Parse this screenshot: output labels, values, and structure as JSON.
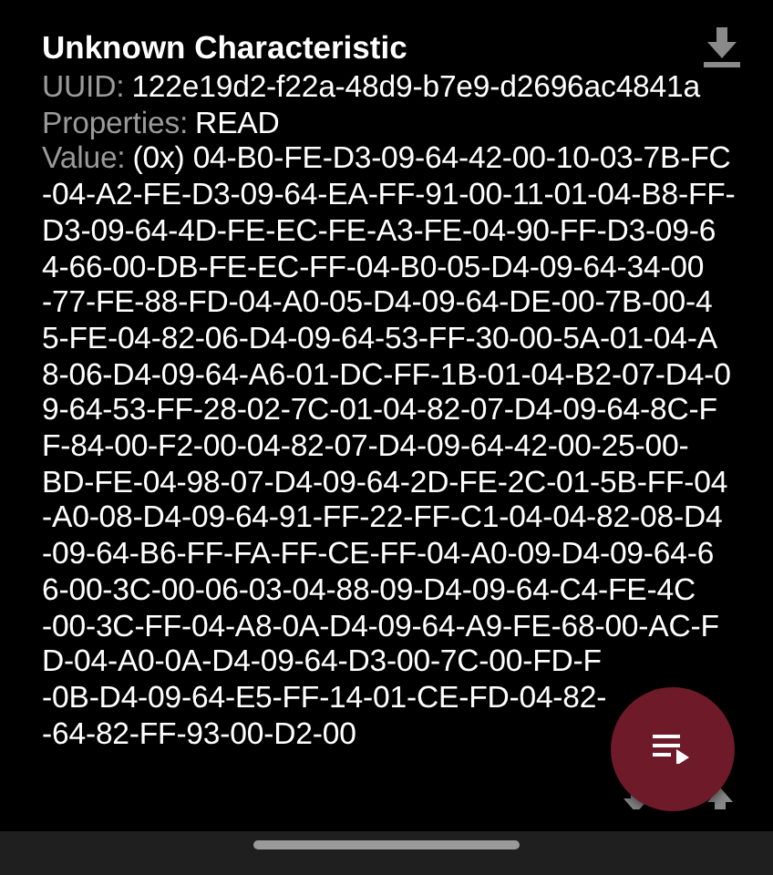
{
  "characteristic": {
    "title": "Unknown Characteristic",
    "uuid_label": "UUID:",
    "uuid": "122e19d2-f22a-48d9-b7e9-d2696ac4841a",
    "properties_label": "Properties:",
    "properties": "READ",
    "value_label": "Value:",
    "value_lines": [
      "(0x) 04-B0-FE-D3-09-64-42-00-10-03-7B-FC",
      "-04-A2-FE-D3-09-64-EA-FF-91-00-11-01-04-B8-FF-",
      "D3-09-64-4D-FE-EC-FE-A3-FE-04-90-FF-D3-09-6",
      "4-66-00-DB-FE-EC-FF-04-B0-05-D4-09-64-34-00",
      "-77-FE-88-FD-04-A0-05-D4-09-64-DE-00-7B-00-4",
      "5-FE-04-82-06-D4-09-64-53-FF-30-00-5A-01-04-A",
      "8-06-D4-09-64-A6-01-DC-FF-1B-01-04-B2-07-D4-0",
      "9-64-53-FF-28-02-7C-01-04-82-07-D4-09-64-8C-F",
      "F-84-00-F2-00-04-82-07-D4-09-64-42-00-25-00-",
      "BD-FE-04-98-07-D4-09-64-2D-FE-2C-01-5B-FF-04",
      "-A0-08-D4-09-64-91-FF-22-FF-C1-04-04-82-08-D4",
      "-09-64-B6-FF-FA-FF-CE-FF-04-A0-09-D4-09-64-6",
      "6-00-3C-00-06-03-04-88-09-D4-09-64-C4-FE-4C",
      "-00-3C-FF-04-A8-0A-D4-09-64-A9-FE-68-00-AC-F",
      "D-04-A0-0A-D4-09-64-D3-00-7C-00-FD-F",
      "-0B-D4-09-64-E5-FF-14-01-CE-FD-04-82-",
      "-64-82-FF-93-00-D2-00"
    ]
  }
}
